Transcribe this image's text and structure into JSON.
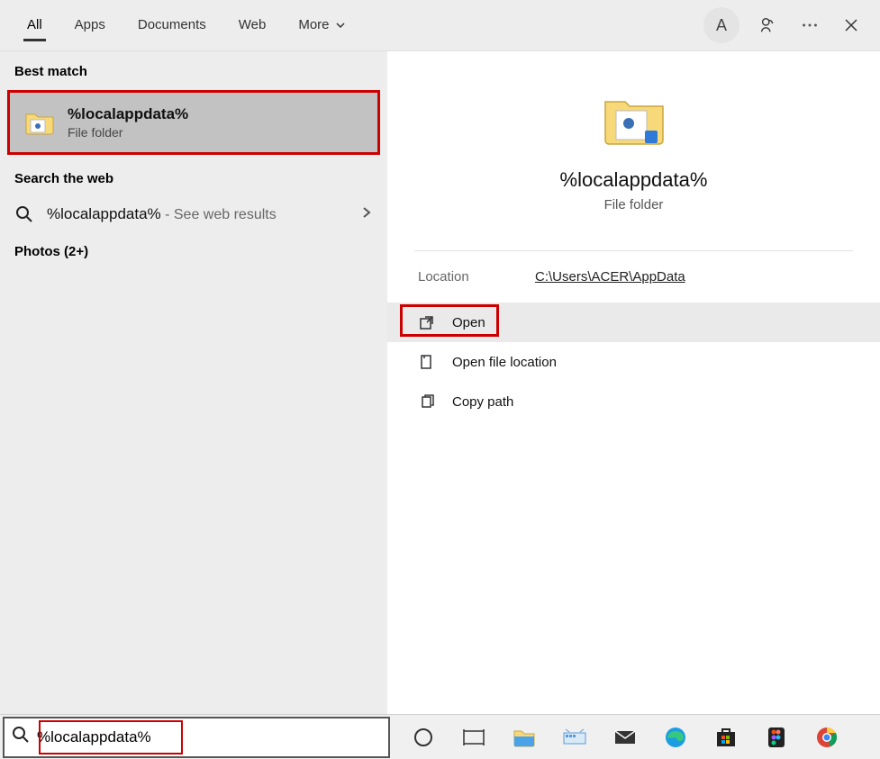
{
  "tabs": {
    "all": "All",
    "apps": "Apps",
    "documents": "Documents",
    "web": "Web",
    "more": "More"
  },
  "avatar_initial": "A",
  "left": {
    "best_match_header": "Best match",
    "best_match": {
      "title": "%localappdata%",
      "subtitle": "File folder"
    },
    "search_web_header": "Search the web",
    "web_result": {
      "primary": "%localappdata%",
      "suffix": " - See web results"
    },
    "photos_header": "Photos (2+)"
  },
  "details": {
    "title": "%localappdata%",
    "subtitle": "File folder",
    "location_label": "Location",
    "location_value": "C:\\Users\\ACER\\AppData",
    "actions": {
      "open": "Open",
      "open_location": "Open file location",
      "copy_path": "Copy path"
    }
  },
  "search": {
    "value": "%localappdata%"
  }
}
